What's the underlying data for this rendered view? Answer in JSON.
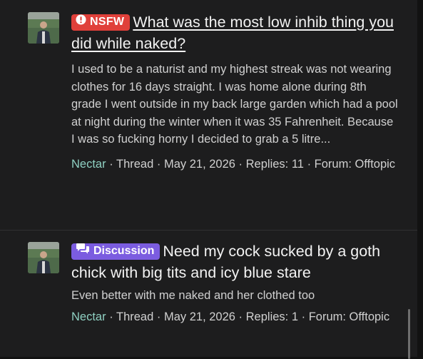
{
  "colors": {
    "nsfw_badge": "#e0403a",
    "discussion_badge": "#7b5ce0",
    "author_link": "#8fd0c2",
    "background": "#1d1d1e"
  },
  "posts": [
    {
      "badge": {
        "label": "NSFW",
        "icon": "alert-circle-icon"
      },
      "title": "What was the most low inhib thing you did while naked?",
      "snippet": "I used to be a naturist and my highest streak was not wearing clothes for 16 days straight. I was home alone during 8th grade I went outside in my back large garden which had a pool at night during the winter when it was 35 Fahrenheit. Because I was so fucking horny I decided to grab a 5 litre...",
      "author": "Nectar",
      "type": "Thread",
      "date": "May 21, 2026",
      "replies": "Replies: 11",
      "forum": "Forum: Offtopic",
      "sep": "·"
    },
    {
      "badge": {
        "label": "Discussion",
        "icon": "chat-bubbles-icon"
      },
      "title": "Need my cock sucked by a goth chick with big tits and icy blue stare",
      "snippet": "Even better with me naked and her clothed too",
      "author": "Nectar",
      "type": "Thread",
      "date": "May 21, 2026",
      "replies": "Replies: 1",
      "forum": "Forum: Offtopic",
      "sep": "·"
    }
  ]
}
